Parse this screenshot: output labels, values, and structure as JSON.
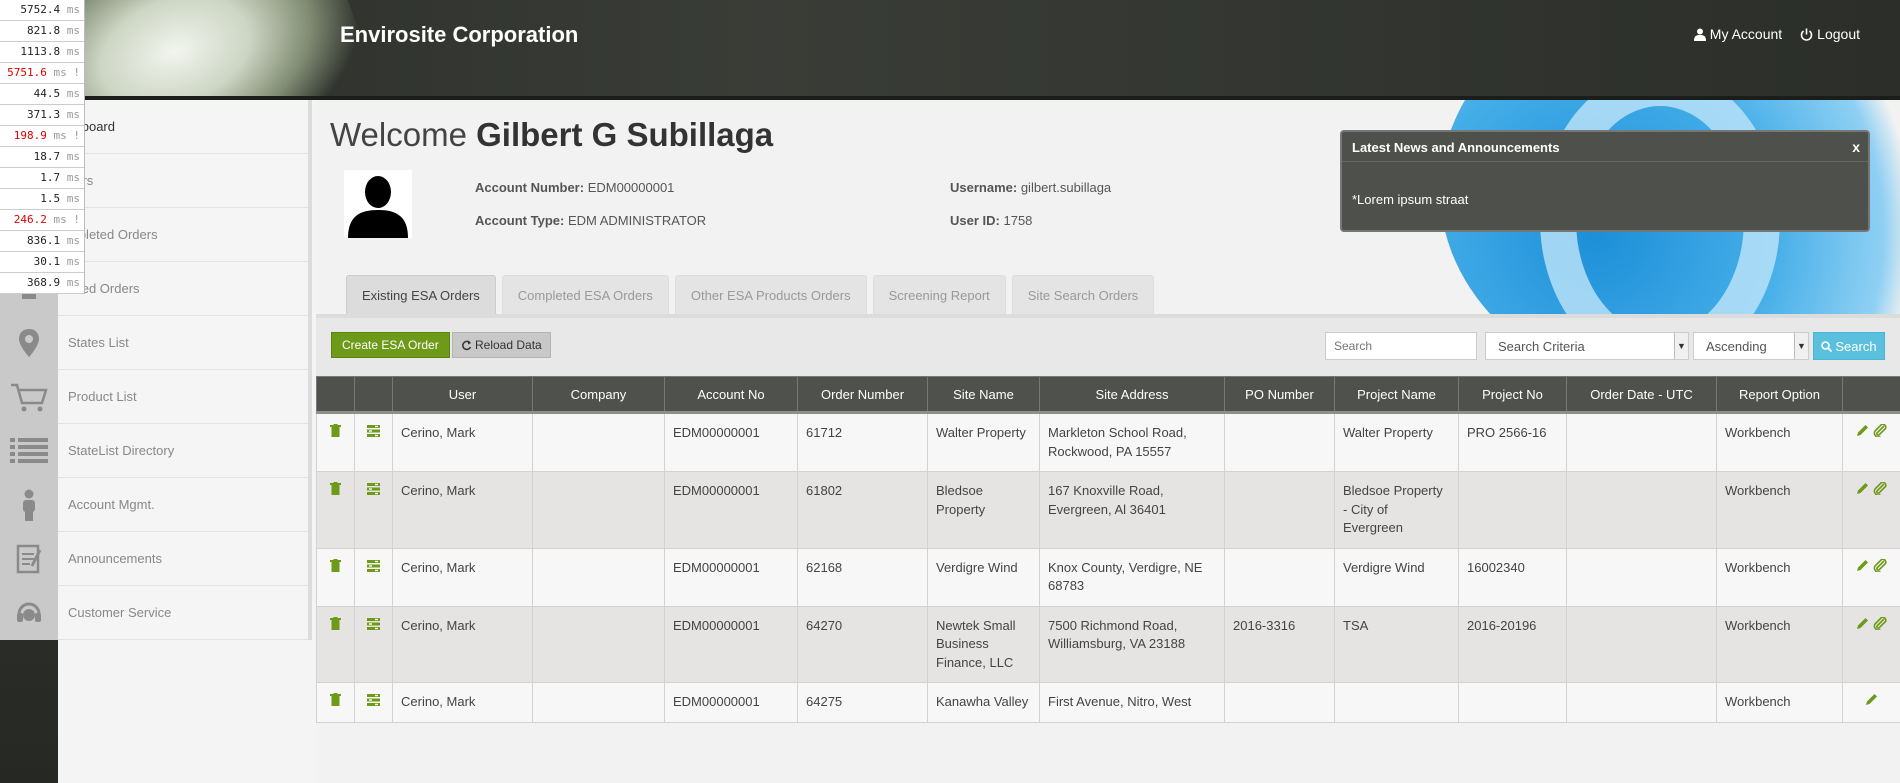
{
  "header": {
    "brand": "Envirosite Corporation",
    "my_account": "My Account",
    "logout": "Logout"
  },
  "timings": [
    {
      "value": "5752.4",
      "unit": "ms",
      "alert": false
    },
    {
      "value": "821.8",
      "unit": "ms",
      "alert": false
    },
    {
      "value": "1113.8",
      "unit": "ms",
      "alert": false
    },
    {
      "value": "5751.6",
      "unit": "ms !",
      "alert": true
    },
    {
      "value": "44.5",
      "unit": "ms",
      "alert": false
    },
    {
      "value": "371.3",
      "unit": "ms",
      "alert": false
    },
    {
      "value": "198.9",
      "unit": "ms !",
      "alert": true
    },
    {
      "value": "18.7",
      "unit": "ms",
      "alert": false
    },
    {
      "value": "1.7",
      "unit": "ms",
      "alert": false
    },
    {
      "value": "1.5",
      "unit": "ms",
      "alert": false
    },
    {
      "value": "246.2",
      "unit": "ms !",
      "alert": true
    },
    {
      "value": "836.1",
      "unit": "ms",
      "alert": false
    },
    {
      "value": "30.1",
      "unit": "ms",
      "alert": false
    },
    {
      "value": "368.9",
      "unit": "ms",
      "alert": false
    }
  ],
  "sidebar": {
    "items": [
      {
        "label": "shboard",
        "icon": "dashboard-icon"
      },
      {
        "label": "ders",
        "icon": "orders-icon"
      },
      {
        "label": "mpleted Orders",
        "icon": "completed-orders-icon"
      },
      {
        "label": "leted Orders",
        "icon": "trash-icon"
      },
      {
        "label": "States List",
        "icon": "map-pin-icon"
      },
      {
        "label": "Product List",
        "icon": "cart-icon"
      },
      {
        "label": "StateList Directory",
        "icon": "list-icon"
      },
      {
        "label": "Account Mgmt.",
        "icon": "person-icon"
      },
      {
        "label": "Announcements",
        "icon": "notepad-icon"
      },
      {
        "label": "Customer Service",
        "icon": "headset-icon"
      }
    ]
  },
  "welcome": {
    "prefix": "Welcome",
    "name": "Gilbert G Subillaga"
  },
  "account": {
    "account_number_label": "Account Number:",
    "account_number": "EDM00000001",
    "account_type_label": "Account Type:",
    "account_type": "EDM ADMINISTRATOR",
    "username_label": "Username:",
    "username": "gilbert.subillaga",
    "user_id_label": "User ID:",
    "user_id": "1758"
  },
  "news": {
    "title": "Latest News and Announcements",
    "close": "x",
    "body": "*Lorem ipsum straat"
  },
  "tabs": [
    "Existing ESA Orders",
    "Completed ESA Orders",
    "Other ESA Products Orders",
    "Screening Report",
    "Site Search Orders"
  ],
  "toolbar": {
    "create": "Create ESA Order",
    "reload": "Reload Data",
    "search_placeholder": "Search",
    "criteria": "Search Criteria",
    "order": "Ascending",
    "search_button": "Search"
  },
  "table": {
    "columns": [
      "",
      "",
      "User",
      "Company",
      "Account No",
      "Order Number",
      "Site Name",
      "Site Address",
      "PO Number",
      "Project Name",
      "Project No",
      "Order Date - UTC",
      "Report Option",
      ""
    ],
    "rows": [
      {
        "user": "Cerino, Mark",
        "company": "",
        "account": "EDM00000001",
        "order": "61712",
        "site": "Walter Property",
        "address": "Markleton School Road, Rockwood, PA 15557",
        "po": "",
        "project": "Walter Property",
        "project_no": "PRO 2566-16",
        "date": "",
        "report": "Workbench",
        "attach": true
      },
      {
        "user": "Cerino, Mark",
        "company": "",
        "account": "EDM00000001",
        "order": "61802",
        "site": "Bledsoe Property",
        "address": "167 Knoxville Road, Evergreen, Al 36401",
        "po": "",
        "project": "Bledsoe Property - City of Evergreen",
        "project_no": "",
        "date": "",
        "report": "Workbench",
        "attach": true
      },
      {
        "user": "Cerino, Mark",
        "company": "",
        "account": "EDM00000001",
        "order": "62168",
        "site": "Verdigre Wind",
        "address": "Knox County, Verdigre, NE 68783",
        "po": "",
        "project": "Verdigre Wind",
        "project_no": "16002340",
        "date": "",
        "report": "Workbench",
        "attach": true
      },
      {
        "user": "Cerino, Mark",
        "company": "",
        "account": "EDM00000001",
        "order": "64270",
        "site": "Newtek Small Business Finance, LLC",
        "address": "7500 Richmond Road, Williamsburg, VA 23188",
        "po": "2016-3316",
        "project": "TSA",
        "project_no": "2016-20196",
        "date": "",
        "report": "Workbench",
        "attach": true
      },
      {
        "user": "Cerino, Mark",
        "company": "",
        "account": "EDM00000001",
        "order": "64275",
        "site": "Kanawha Valley",
        "address": "First Avenue, Nitro, West",
        "po": "",
        "project": "",
        "project_no": "",
        "date": "",
        "report": "Workbench",
        "attach": false
      }
    ]
  },
  "colors": {
    "header_bg": "#2a2d28",
    "accent_green": "#6e9a1a",
    "accent_blue": "#5bc0de",
    "table_header": "#4e514c"
  }
}
